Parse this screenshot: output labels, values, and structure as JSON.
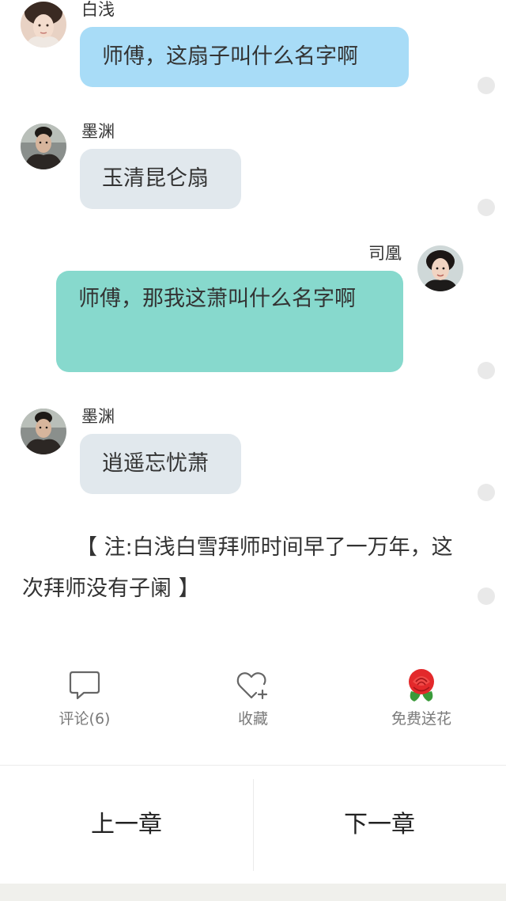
{
  "messages": [
    {
      "speaker": "白浅",
      "text": "师傅，这扇子叫什么名字啊"
    },
    {
      "speaker": "墨渊",
      "text": "玉清昆仑扇"
    },
    {
      "speaker": "司凰",
      "text": "师傅，那我这萧叫什么名字啊"
    },
    {
      "speaker": "墨渊",
      "text": "逍遥忘忧萧"
    }
  ],
  "note": "【 注:白浅白雪拜师时间早了一万年，这次拜师没有子阑 】",
  "actions": {
    "comment_label": "评论(6)",
    "favorite_label": "收藏",
    "flower_label": "免费送花"
  },
  "nav": {
    "prev_label": "上一章",
    "next_label": "下一章"
  },
  "colors": {
    "bubble_blue": "#a8dcf7",
    "bubble_gray": "#e1e8ed",
    "bubble_teal": "#87d9cd"
  },
  "icons": [
    "comment-icon",
    "heart-plus-icon",
    "rose-icon"
  ]
}
